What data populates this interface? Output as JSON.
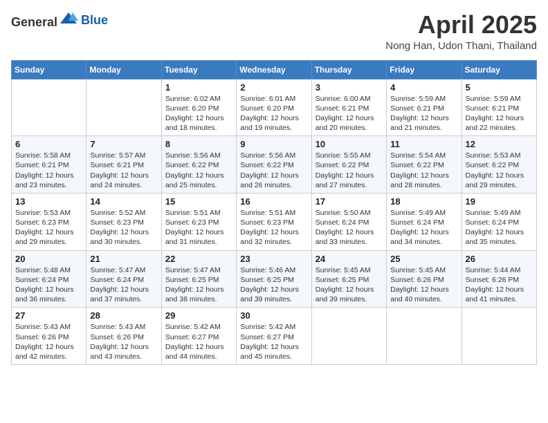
{
  "header": {
    "logo_general": "General",
    "logo_blue": "Blue",
    "month_title": "April 2025",
    "subtitle": "Nong Han, Udon Thani, Thailand"
  },
  "weekdays": [
    "Sunday",
    "Monday",
    "Tuesday",
    "Wednesday",
    "Thursday",
    "Friday",
    "Saturday"
  ],
  "weeks": [
    [
      {
        "day": "",
        "sunrise": "",
        "sunset": "",
        "daylight": ""
      },
      {
        "day": "",
        "sunrise": "",
        "sunset": "",
        "daylight": ""
      },
      {
        "day": "1",
        "sunrise": "Sunrise: 6:02 AM",
        "sunset": "Sunset: 6:20 PM",
        "daylight": "Daylight: 12 hours and 18 minutes."
      },
      {
        "day": "2",
        "sunrise": "Sunrise: 6:01 AM",
        "sunset": "Sunset: 6:20 PM",
        "daylight": "Daylight: 12 hours and 19 minutes."
      },
      {
        "day": "3",
        "sunrise": "Sunrise: 6:00 AM",
        "sunset": "Sunset: 6:21 PM",
        "daylight": "Daylight: 12 hours and 20 minutes."
      },
      {
        "day": "4",
        "sunrise": "Sunrise: 5:59 AM",
        "sunset": "Sunset: 6:21 PM",
        "daylight": "Daylight: 12 hours and 21 minutes."
      },
      {
        "day": "5",
        "sunrise": "Sunrise: 5:59 AM",
        "sunset": "Sunset: 6:21 PM",
        "daylight": "Daylight: 12 hours and 22 minutes."
      }
    ],
    [
      {
        "day": "6",
        "sunrise": "Sunrise: 5:58 AM",
        "sunset": "Sunset: 6:21 PM",
        "daylight": "Daylight: 12 hours and 23 minutes."
      },
      {
        "day": "7",
        "sunrise": "Sunrise: 5:57 AM",
        "sunset": "Sunset: 6:21 PM",
        "daylight": "Daylight: 12 hours and 24 minutes."
      },
      {
        "day": "8",
        "sunrise": "Sunrise: 5:56 AM",
        "sunset": "Sunset: 6:22 PM",
        "daylight": "Daylight: 12 hours and 25 minutes."
      },
      {
        "day": "9",
        "sunrise": "Sunrise: 5:56 AM",
        "sunset": "Sunset: 6:22 PM",
        "daylight": "Daylight: 12 hours and 26 minutes."
      },
      {
        "day": "10",
        "sunrise": "Sunrise: 5:55 AM",
        "sunset": "Sunset: 6:22 PM",
        "daylight": "Daylight: 12 hours and 27 minutes."
      },
      {
        "day": "11",
        "sunrise": "Sunrise: 5:54 AM",
        "sunset": "Sunset: 6:22 PM",
        "daylight": "Daylight: 12 hours and 28 minutes."
      },
      {
        "day": "12",
        "sunrise": "Sunrise: 5:53 AM",
        "sunset": "Sunset: 6:22 PM",
        "daylight": "Daylight: 12 hours and 29 minutes."
      }
    ],
    [
      {
        "day": "13",
        "sunrise": "Sunrise: 5:53 AM",
        "sunset": "Sunset: 6:23 PM",
        "daylight": "Daylight: 12 hours and 29 minutes."
      },
      {
        "day": "14",
        "sunrise": "Sunrise: 5:52 AM",
        "sunset": "Sunset: 6:23 PM",
        "daylight": "Daylight: 12 hours and 30 minutes."
      },
      {
        "day": "15",
        "sunrise": "Sunrise: 5:51 AM",
        "sunset": "Sunset: 6:23 PM",
        "daylight": "Daylight: 12 hours and 31 minutes."
      },
      {
        "day": "16",
        "sunrise": "Sunrise: 5:51 AM",
        "sunset": "Sunset: 6:23 PM",
        "daylight": "Daylight: 12 hours and 32 minutes."
      },
      {
        "day": "17",
        "sunrise": "Sunrise: 5:50 AM",
        "sunset": "Sunset: 6:24 PM",
        "daylight": "Daylight: 12 hours and 33 minutes."
      },
      {
        "day": "18",
        "sunrise": "Sunrise: 5:49 AM",
        "sunset": "Sunset: 6:24 PM",
        "daylight": "Daylight: 12 hours and 34 minutes."
      },
      {
        "day": "19",
        "sunrise": "Sunrise: 5:49 AM",
        "sunset": "Sunset: 6:24 PM",
        "daylight": "Daylight: 12 hours and 35 minutes."
      }
    ],
    [
      {
        "day": "20",
        "sunrise": "Sunrise: 5:48 AM",
        "sunset": "Sunset: 6:24 PM",
        "daylight": "Daylight: 12 hours and 36 minutes."
      },
      {
        "day": "21",
        "sunrise": "Sunrise: 5:47 AM",
        "sunset": "Sunset: 6:24 PM",
        "daylight": "Daylight: 12 hours and 37 minutes."
      },
      {
        "day": "22",
        "sunrise": "Sunrise: 5:47 AM",
        "sunset": "Sunset: 6:25 PM",
        "daylight": "Daylight: 12 hours and 38 minutes."
      },
      {
        "day": "23",
        "sunrise": "Sunrise: 5:46 AM",
        "sunset": "Sunset: 6:25 PM",
        "daylight": "Daylight: 12 hours and 39 minutes."
      },
      {
        "day": "24",
        "sunrise": "Sunrise: 5:45 AM",
        "sunset": "Sunset: 6:25 PM",
        "daylight": "Daylight: 12 hours and 39 minutes."
      },
      {
        "day": "25",
        "sunrise": "Sunrise: 5:45 AM",
        "sunset": "Sunset: 6:26 PM",
        "daylight": "Daylight: 12 hours and 40 minutes."
      },
      {
        "day": "26",
        "sunrise": "Sunrise: 5:44 AM",
        "sunset": "Sunset: 6:26 PM",
        "daylight": "Daylight: 12 hours and 41 minutes."
      }
    ],
    [
      {
        "day": "27",
        "sunrise": "Sunrise: 5:43 AM",
        "sunset": "Sunset: 6:26 PM",
        "daylight": "Daylight: 12 hours and 42 minutes."
      },
      {
        "day": "28",
        "sunrise": "Sunrise: 5:43 AM",
        "sunset": "Sunset: 6:26 PM",
        "daylight": "Daylight: 12 hours and 43 minutes."
      },
      {
        "day": "29",
        "sunrise": "Sunrise: 5:42 AM",
        "sunset": "Sunset: 6:27 PM",
        "daylight": "Daylight: 12 hours and 44 minutes."
      },
      {
        "day": "30",
        "sunrise": "Sunrise: 5:42 AM",
        "sunset": "Sunset: 6:27 PM",
        "daylight": "Daylight: 12 hours and 45 minutes."
      },
      {
        "day": "",
        "sunrise": "",
        "sunset": "",
        "daylight": ""
      },
      {
        "day": "",
        "sunrise": "",
        "sunset": "",
        "daylight": ""
      },
      {
        "day": "",
        "sunrise": "",
        "sunset": "",
        "daylight": ""
      }
    ]
  ]
}
